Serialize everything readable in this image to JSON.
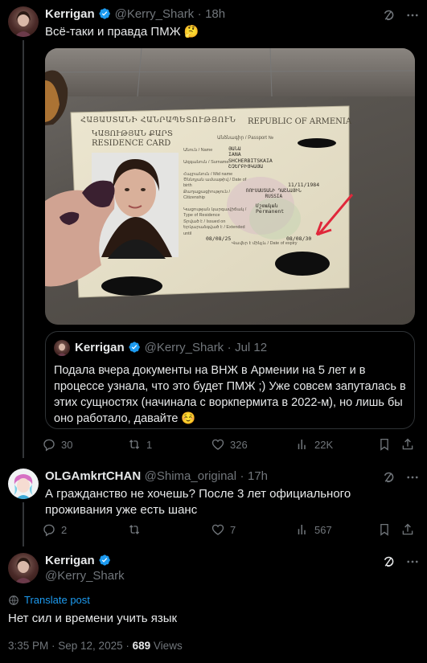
{
  "tweet1": {
    "name": "Kerrigan",
    "handle": "@Kerry_Shark",
    "sep": "·",
    "time": "18h",
    "text": "Всё-таки и правда ПМЖ 🤔",
    "card": {
      "header_ru": "ՀԱՅԱՍՏԱՆԻ ՀԱՆՐԱՊԵՏՈՒԹՅՈՒՆ",
      "header_en": "REPUBLIC OF ARMENIA",
      "card_title_am": "ԿԱՑՈՒԹՅԱՆ ՔԱՐՏ",
      "card_title_en": "RESIDENCE CARD",
      "name_label": "Անուն / Name",
      "name_am": "ՅԱՆԱ",
      "name_en": "IANA",
      "surname_label": "Ազգանուն / Surname",
      "surname_en": "SHCHERBITSKAIA",
      "surname_am": "ՇՉԵՐԲԻՑԿԱՅԱ",
      "midname_label": "Հայրանուն / Mid name",
      "dob_label": "Ծննդյան ամսաթիվ / Date of birth",
      "dob": "11/11/1984",
      "citizenship_label": "Քաղաքացիություն / Citizenship",
      "citizenship_am": "ՌՈՒՍԱՍՏԱՆԻ ԴԱՇՆԱՅԻՆ",
      "citizenship_en": "RUSSIA",
      "residence_type_label": "Կացության կարգավիճակ / Type of Residence",
      "residence_type_am": "Մշտական",
      "residence_type_en": "Permanent",
      "issued_label": "Տրված է / Issued on",
      "issued": "08/08/25",
      "expiry_label": "Վավեր է մինչև / Date of expiry",
      "expiry": "08/08/30",
      "passport_label": "Անձնագիր / Passport №",
      "extended_label": "Երկարաձգված է / Extended until"
    },
    "quote": {
      "name": "Kerrigan",
      "handle": "@Kerry_Shark",
      "sep": "·",
      "time": "Jul 12",
      "text": "Подала вчера документы на ВНЖ в Армении на 5 лет и в процессе узнала, что это будет ПМЖ ;) Уже совсем запуталась в этих сущностях (начинала с воркпермита в 2022-м), но лишь бы оно работало, давайте ☺️"
    },
    "stats": {
      "replies": "30",
      "reposts": "1",
      "likes": "326",
      "views": "22K"
    }
  },
  "tweet2": {
    "name": "OLGAmkrtCHAN",
    "handle": "@Shima_original",
    "sep": "·",
    "time": "17h",
    "text": "А гражданство не хочешь? После 3 лет официального проживания уже есть шанс",
    "stats": {
      "replies": "2",
      "reposts": "",
      "likes": "7",
      "views": "567"
    }
  },
  "tweet3": {
    "name": "Kerrigan",
    "handle": "@Kerry_Shark",
    "translate": "Translate post",
    "text": "Нет сил и времени учить язык",
    "time": "3:35 PM · Sep 12, 2025",
    "sep": "·",
    "views_count": "689",
    "views_label": "Views"
  },
  "colors": {
    "accent": "#1d9bf0",
    "muted": "#71767b",
    "border": "#2f3336",
    "background": "#000000",
    "text": "#e7e9ea"
  },
  "icons": {
    "verified": "verified-badge-icon",
    "grok": "grok-icon",
    "reply": "reply-icon",
    "repost": "repost-icon",
    "like": "heart-icon",
    "views": "views-icon",
    "share": "share-icon",
    "translate": "translate-icon"
  }
}
